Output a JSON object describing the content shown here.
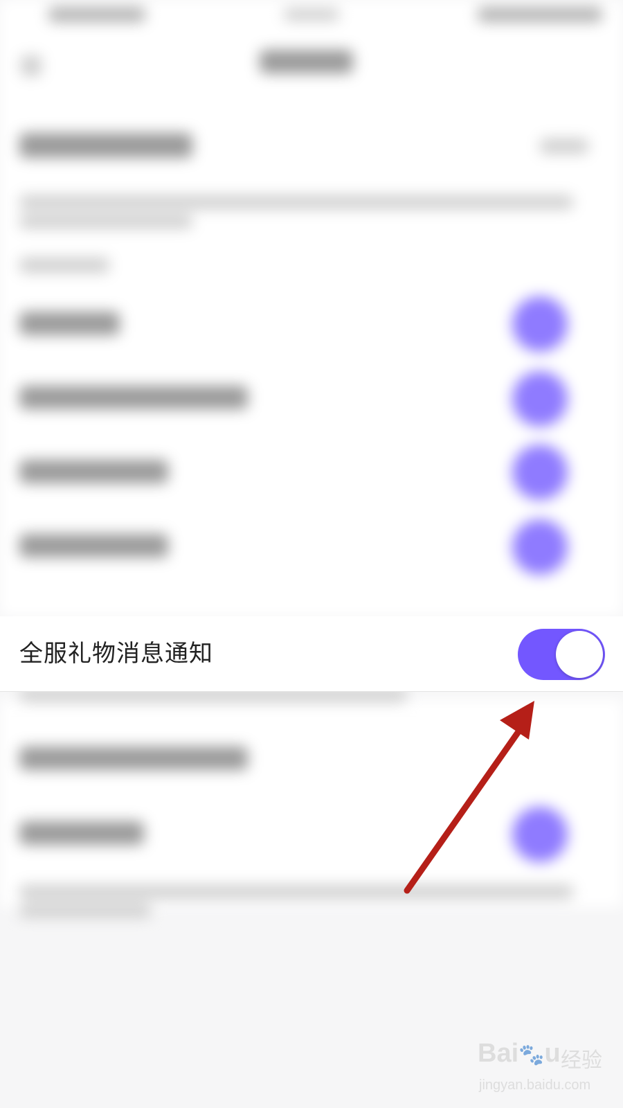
{
  "setting_row": {
    "label": "全服礼物消息通知",
    "toggle_on": true
  },
  "colors": {
    "toggle_track": "#7357ff",
    "toggle_knob": "#ffffff",
    "arrow": "#b51f18",
    "background": "#f6f6f7"
  },
  "watermark": {
    "logo_left": "Bai",
    "logo_icon": "paw-icon",
    "logo_right": "u",
    "brand_cn": "经验",
    "url": "jingyan.baidu.com"
  }
}
